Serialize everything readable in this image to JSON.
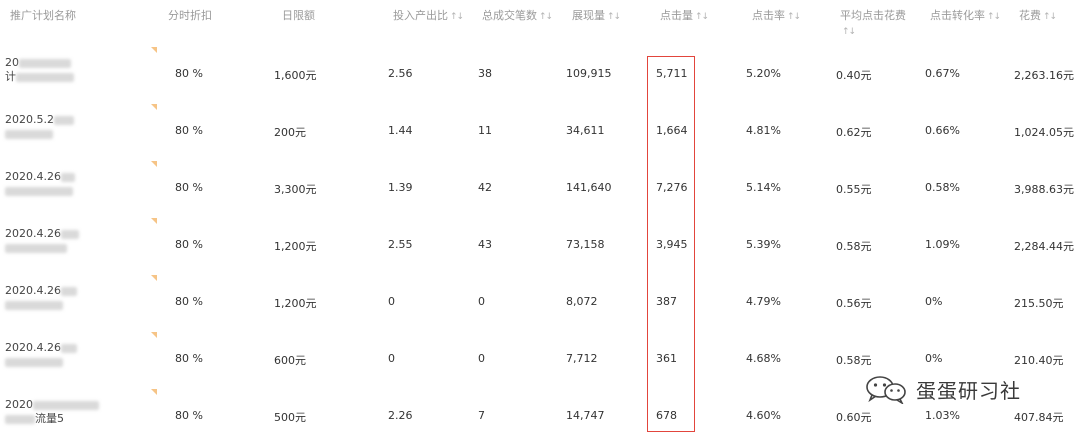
{
  "headers": [
    {
      "label": "推广计划名称",
      "sort": ""
    },
    {
      "label": "分时折扣",
      "sort": ""
    },
    {
      "label": "日限额",
      "sort": ""
    },
    {
      "label": "投入产出比",
      "sort": "↑↓"
    },
    {
      "label": "总成交笔数",
      "sort": "↑↓"
    },
    {
      "label": "展现量",
      "sort": "↑↓"
    },
    {
      "label": "点击量",
      "sort": "↑↓"
    },
    {
      "label": "点击率",
      "sort": "↑↓"
    },
    {
      "label": "平均点击花费",
      "sort": "↑↓"
    },
    {
      "label": "点击转化率",
      "sort": "↑↓"
    },
    {
      "label": "花费",
      "sort": "↑↓"
    }
  ],
  "rows": [
    {
      "name1": "20",
      "name2": "计",
      "discount": "80 %",
      "limit": "1,600元",
      "roi": "2.56",
      "orders": "38",
      "impressions": "109,915",
      "clicks": "5,711",
      "ctr": "5.20%",
      "cpc": "0.40元",
      "cvr": "0.67%",
      "cost": "2,263.16元"
    },
    {
      "name1": "2020.5.2",
      "name2": "",
      "discount": "80 %",
      "limit": "200元",
      "roi": "1.44",
      "orders": "11",
      "impressions": "34,611",
      "clicks": "1,664",
      "ctr": "4.81%",
      "cpc": "0.62元",
      "cvr": "0.66%",
      "cost": "1,024.05元"
    },
    {
      "name1": "2020.4.26",
      "name2": "",
      "discount": "80 %",
      "limit": "3,300元",
      "roi": "1.39",
      "orders": "42",
      "impressions": "141,640",
      "clicks": "7,276",
      "ctr": "5.14%",
      "cpc": "0.55元",
      "cvr": "0.58%",
      "cost": "3,988.63元"
    },
    {
      "name1": "2020.4.26",
      "name2": "",
      "discount": "80 %",
      "limit": "1,200元",
      "roi": "2.55",
      "orders": "43",
      "impressions": "73,158",
      "clicks": "3,945",
      "ctr": "5.39%",
      "cpc": "0.58元",
      "cvr": "1.09%",
      "cost": "2,284.44元"
    },
    {
      "name1": "2020.4.26",
      "name2": "",
      "discount": "80 %",
      "limit": "1,200元",
      "roi": "0",
      "orders": "0",
      "impressions": "8,072",
      "clicks": "387",
      "ctr": "4.79%",
      "cpc": "0.56元",
      "cvr": "0%",
      "cost": "215.50元"
    },
    {
      "name1": "2020.4.26",
      "name2": "",
      "discount": "80 %",
      "limit": "600元",
      "roi": "0",
      "orders": "0",
      "impressions": "7,712",
      "clicks": "361",
      "ctr": "4.68%",
      "cpc": "0.58元",
      "cvr": "0%",
      "cost": "210.40元"
    },
    {
      "name1": "2020",
      "name2": "流量5",
      "discount": "80 %",
      "limit": "500元",
      "roi": "2.26",
      "orders": "7",
      "impressions": "14,747",
      "clicks": "678",
      "ctr": "4.60%",
      "cpc": "0.60元",
      "cvr": "1.03%",
      "cost": "407.84元"
    }
  ],
  "watermark": {
    "text": "蛋蛋研习社",
    "icon": "wechat-icon"
  },
  "colors": {
    "highlight": "#e2453c",
    "header_text": "#9a9a9a",
    "corner_mark": "#f6c486"
  }
}
